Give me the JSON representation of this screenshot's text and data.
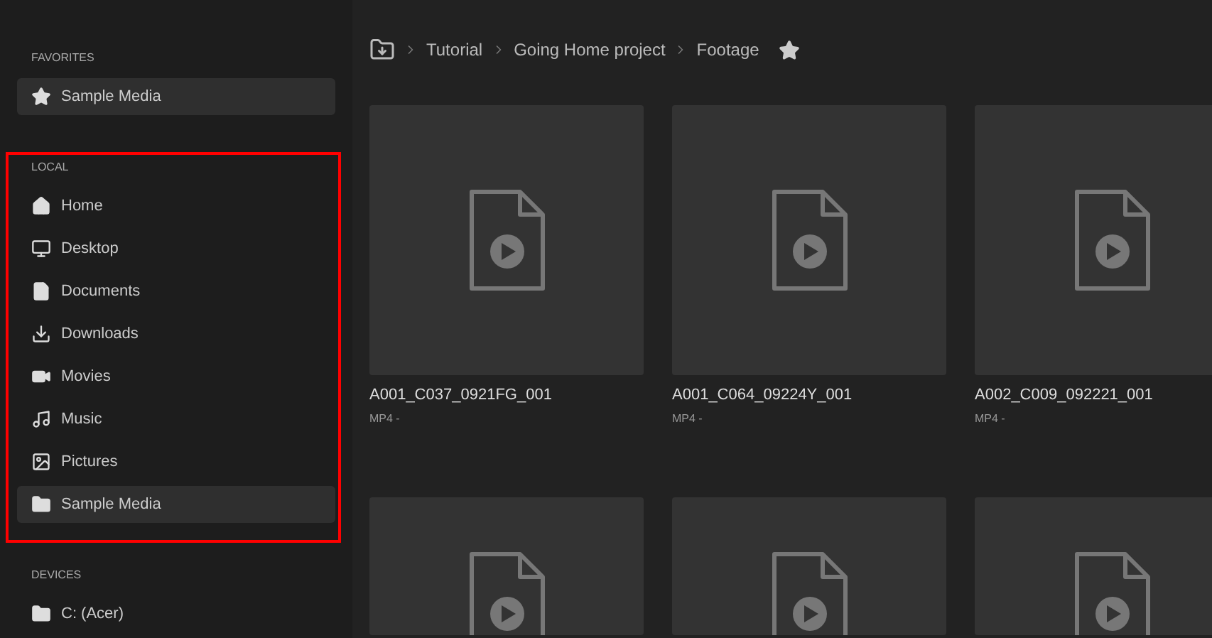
{
  "sidebar": {
    "sections": [
      {
        "title": "FAVORITES",
        "highlighted": false,
        "items": [
          {
            "label": "Sample Media",
            "kind": "star",
            "selected": true
          }
        ]
      },
      {
        "title": "LOCAL",
        "highlighted": true,
        "items": [
          {
            "label": "Home",
            "kind": "home",
            "selected": false
          },
          {
            "label": "Desktop",
            "kind": "monitor",
            "selected": false
          },
          {
            "label": "Documents",
            "kind": "file",
            "selected": false
          },
          {
            "label": "Downloads",
            "kind": "download",
            "selected": false
          },
          {
            "label": "Movies",
            "kind": "video",
            "selected": false
          },
          {
            "label": "Music",
            "kind": "music",
            "selected": false
          },
          {
            "label": "Pictures",
            "kind": "image",
            "selected": false
          },
          {
            "label": "Sample Media",
            "kind": "folder",
            "selected": true
          }
        ]
      },
      {
        "title": "DEVICES",
        "highlighted": false,
        "items": [
          {
            "label": "C: (Acer)",
            "kind": "folder",
            "selected": false
          }
        ]
      }
    ]
  },
  "breadcrumb": {
    "items": [
      "Tutorial",
      "Going Home project",
      "Footage"
    ],
    "favorite": true
  },
  "files": [
    {
      "name": "A001_C037_0921FG_001",
      "meta": "MP4 -"
    },
    {
      "name": "A001_C064_09224Y_001",
      "meta": "MP4 -"
    },
    {
      "name": "A002_C009_092221_001",
      "meta": "MP4 -"
    },
    {
      "kind": "partial"
    },
    {
      "kind": "partial"
    },
    {
      "kind": "partial"
    }
  ]
}
